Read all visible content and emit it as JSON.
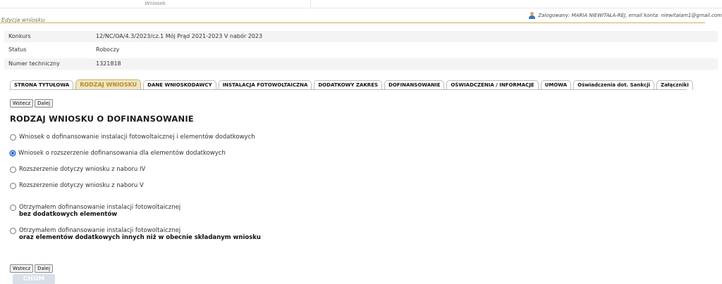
{
  "top": {
    "cell": "Wniosek"
  },
  "header": {
    "edit_title": "Edycja wniosku",
    "login_text": "Zalogowany: MARIA NIEWITAŁA-REJ, email konta: niewitalam1@gmail.com",
    "user_icon": "user-icon"
  },
  "info": [
    {
      "label": "Konkurs",
      "value": "12/NC/OA/4.3/2023/cz.1 Mój Prąd 2021-2023 V nabór 2023"
    },
    {
      "label": "Status",
      "value": "Roboczy"
    },
    {
      "label": "Numer techniczny",
      "value": "1321818"
    }
  ],
  "tabs": [
    {
      "label": "STRONA TYTUŁOWA"
    },
    {
      "label": "RODZAJ WNIOSKU",
      "active": true
    },
    {
      "label": "DANE WNIOSKODAWCY"
    },
    {
      "label": "INSTALACJA FOTOWOLTAICZNA"
    },
    {
      "label": "DODATKOWY ZAKRES"
    },
    {
      "label": "DOFINANSOWANIE"
    },
    {
      "label": "OŚWIADCZENIA / INFORMACJE"
    },
    {
      "label": "UMOWA"
    },
    {
      "label": "Oświadczenia dot. Sankcji"
    },
    {
      "label": "Załączniki"
    }
  ],
  "nav": {
    "back": "Wstecz",
    "next": "Dalej"
  },
  "section": {
    "heading": "RODZAJ WNIOSKU O DOFINANSOWANIE"
  },
  "options": [
    {
      "text": "Wniosek o dofinansowanie instalacji fotowoltaicznej i elementów dodatkowych",
      "checked": false
    },
    {
      "text": "Wniosek o rozszerzenie dofinansowania dla elementów dodatkowych",
      "checked": true
    },
    {
      "text": "Rozszerzenie dotyczy wniosku z naboru IV",
      "checked": false
    },
    {
      "text": "Rozszerzenie dotyczy wniosku z naboru V",
      "checked": false
    },
    {
      "text": "Otrzymałem dofinansowanie instalacji fotowoltaicznej",
      "bold": "bez dodatkowych elementów",
      "checked": false
    },
    {
      "text": "Otrzymałem dofinansowanie instalacji fotowoltaicznej",
      "bold": "oraz elementów dodatkowych innych niż w obecnie składanym wniosku",
      "checked": false
    }
  ],
  "footer_logo": "CHUM",
  "colors": {
    "accent": "#c9b25a",
    "active_tab_bg": "#efe6c0",
    "radio_checked": "#1b62c9"
  }
}
